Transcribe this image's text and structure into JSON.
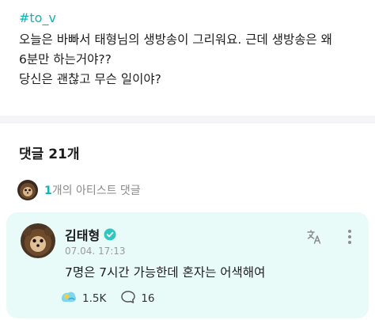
{
  "post": {
    "hashtag": "#to_v",
    "lines": [
      "오늘은 바빠서 태형님의 생방송이 그리워요.  근데 생방송은 왜",
      "6분만 하는거야??",
      "당신은 괜찮고 무슨 일이야?"
    ]
  },
  "comments": {
    "title": "댓글 21개",
    "artist_count": "1",
    "artist_suffix": "개의 아티스트 댓글"
  },
  "comment": {
    "author": "김태형",
    "timestamp": "07.04. 17:13",
    "text": "7명은 7시간 가능한데 혼자는 어색해여",
    "likes": "1.5K",
    "replies": "16"
  },
  "colors": {
    "accent": "#10b4b4",
    "card_bg": "#e9fbf8",
    "verified": "#2fc7c0"
  },
  "icons": [
    "verified-badge-icon",
    "translate-icon",
    "more-vertical-icon",
    "reaction-icon",
    "comment-bubble-icon"
  ]
}
